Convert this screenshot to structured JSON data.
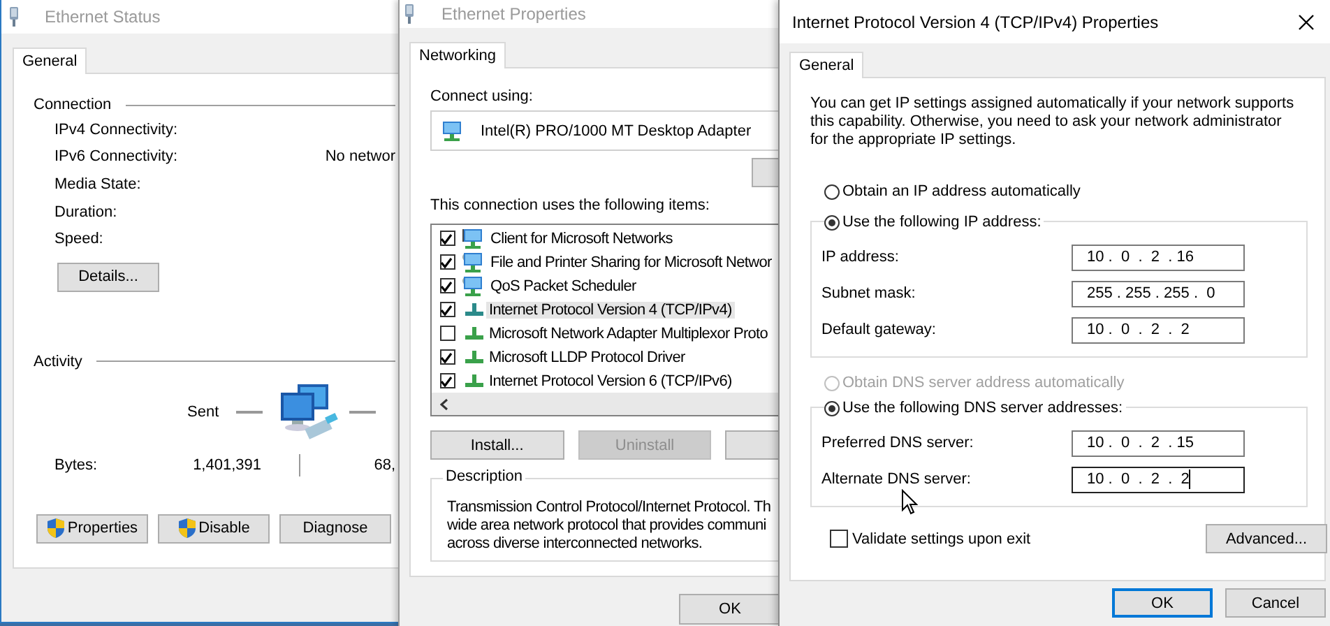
{
  "status_window": {
    "title": "Ethernet Status",
    "tabs": [
      {
        "label": "General",
        "selected": true
      }
    ],
    "connection": {
      "heading": "Connection",
      "rows": [
        {
          "label": "IPv4 Connectivity:"
        },
        {
          "label": "IPv6 Connectivity:",
          "value": "No networ"
        },
        {
          "label": "Media State:"
        },
        {
          "label": "Duration:"
        },
        {
          "label": "Speed:"
        }
      ]
    },
    "details_button": "Details...",
    "activity": {
      "heading": "Activity",
      "sent_label": "Sent",
      "bytes_label": "Bytes:",
      "sent_value": "1,401,391",
      "received_value": "68,"
    },
    "buttons": [
      {
        "label": "Properties",
        "kind": "shield"
      },
      {
        "label": "Disable",
        "kind": "shield"
      },
      {
        "label": "Diagnose",
        "kind": "plain"
      }
    ]
  },
  "properties_window": {
    "title": "Ethernet Properties",
    "tabs": [
      {
        "label": "Networking",
        "selected": true
      }
    ],
    "connect_using_label": "Connect using:",
    "adapter": "Intel(R) PRO/1000 MT Desktop Adapter",
    "items_label": "This connection uses the following items:",
    "items": [
      {
        "label": "Client for Microsoft Networks",
        "checked": true,
        "selected": false,
        "kind": "client"
      },
      {
        "label": "File and Printer Sharing for Microsoft Networ",
        "checked": true,
        "selected": false,
        "kind": "service"
      },
      {
        "label": "QoS Packet Scheduler",
        "checked": true,
        "selected": false,
        "kind": "service"
      },
      {
        "label": "Internet Protocol Version 4 (TCP/IPv4)",
        "checked": true,
        "selected": true,
        "kind": "protocol"
      },
      {
        "label": "Microsoft Network Adapter Multiplexor Proto",
        "checked": false,
        "selected": false,
        "kind": "protocol"
      },
      {
        "label": "Microsoft LLDP Protocol Driver",
        "checked": true,
        "selected": false,
        "kind": "protocol"
      },
      {
        "label": "Internet Protocol Version 6 (TCP/IPv6)",
        "checked": true,
        "selected": false,
        "kind": "protocol"
      }
    ],
    "buttons": [
      {
        "label": "Install...",
        "disabled": false
      },
      {
        "label": "Uninstall",
        "disabled": true
      }
    ],
    "description": {
      "heading": "Description",
      "text": "Transmission Control Protocol/Internet Protocol. Th\nwide area network protocol that provides communi\nacross diverse interconnected networks."
    },
    "ok_button": "OK"
  },
  "ipv4_window": {
    "title": "Internet Protocol Version 4 (TCP/IPv4) Properties",
    "tabs": [
      {
        "label": "General",
        "selected": true
      }
    ],
    "intro": "You can get IP settings assigned automatically if your network supports this capability. Otherwise, you need to ask your network administrator for the appropriate IP settings.",
    "ip_modes": [
      {
        "label": "Obtain an IP address automatically",
        "selected": false,
        "disabled": false
      },
      {
        "label": "Use the following IP address:",
        "selected": true,
        "disabled": false
      }
    ],
    "ip_fields": [
      {
        "label": "IP address:",
        "value": "10 .  0  .  2  . 16",
        "focused": false
      },
      {
        "label": "Subnet mask:",
        "value": "255 . 255 . 255 .  0",
        "focused": false
      },
      {
        "label": "Default gateway:",
        "value": "10 .  0  .  2  .  2",
        "focused": false
      }
    ],
    "dns_modes": [
      {
        "label": "Obtain DNS server address automatically",
        "selected": false,
        "disabled": true
      },
      {
        "label": "Use the following DNS server addresses:",
        "selected": true,
        "disabled": false
      }
    ],
    "dns_fields": [
      {
        "label": "Preferred DNS server:",
        "value": "10 .  0  .  2  . 15",
        "focused": false
      },
      {
        "label": "Alternate DNS server:",
        "value": "10 .  0  .  2  .  2",
        "focused": true
      }
    ],
    "validate": {
      "label": "Validate settings upon exit",
      "checked": false
    },
    "advanced_button": "Advanced...",
    "buttons": [
      {
        "label": "OK",
        "default": true
      },
      {
        "label": "Cancel",
        "default": false
      }
    ]
  }
}
